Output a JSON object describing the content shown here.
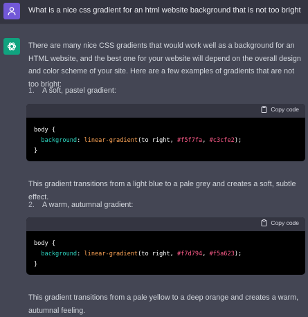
{
  "user_message": "What is a nice css gradient for an html website background that is not too bright",
  "intro": "There are many nice CSS gradients that would work well as a background for an HTML website, and the best one for your website will depend on the overall design and color scheme of your site. Here are a few examples of gradients that are not too bright:",
  "items": [
    {
      "number": "1.",
      "title": "A soft, pastel gradient:",
      "code": {
        "copy_label": "Copy code",
        "line1": "body {",
        "prop": "background",
        "colon": ":",
        "fn": "linear-gradient",
        "args_prefix": "(to right, ",
        "color1": "#f5f7fa",
        "sep": ", ",
        "color2": "#c3cfe2",
        "args_suffix": ");",
        "line3": "}"
      },
      "description": "This gradient transitions from a light blue to a pale grey and creates a soft, subtle effect."
    },
    {
      "number": "2.",
      "title": "A warm, autumnal gradient:",
      "code": {
        "copy_label": "Copy code",
        "line1": "body {",
        "prop": "background",
        "colon": ":",
        "fn": "linear-gradient",
        "args_prefix": "(to right, ",
        "color1": "#f7d794",
        "sep": ", ",
        "color2": "#f5a623",
        "args_suffix": ");",
        "line3": "}"
      },
      "description": "This gradient transitions from a pale yellow to a deep orange and creates a warm, autumnal feeling."
    }
  ]
}
